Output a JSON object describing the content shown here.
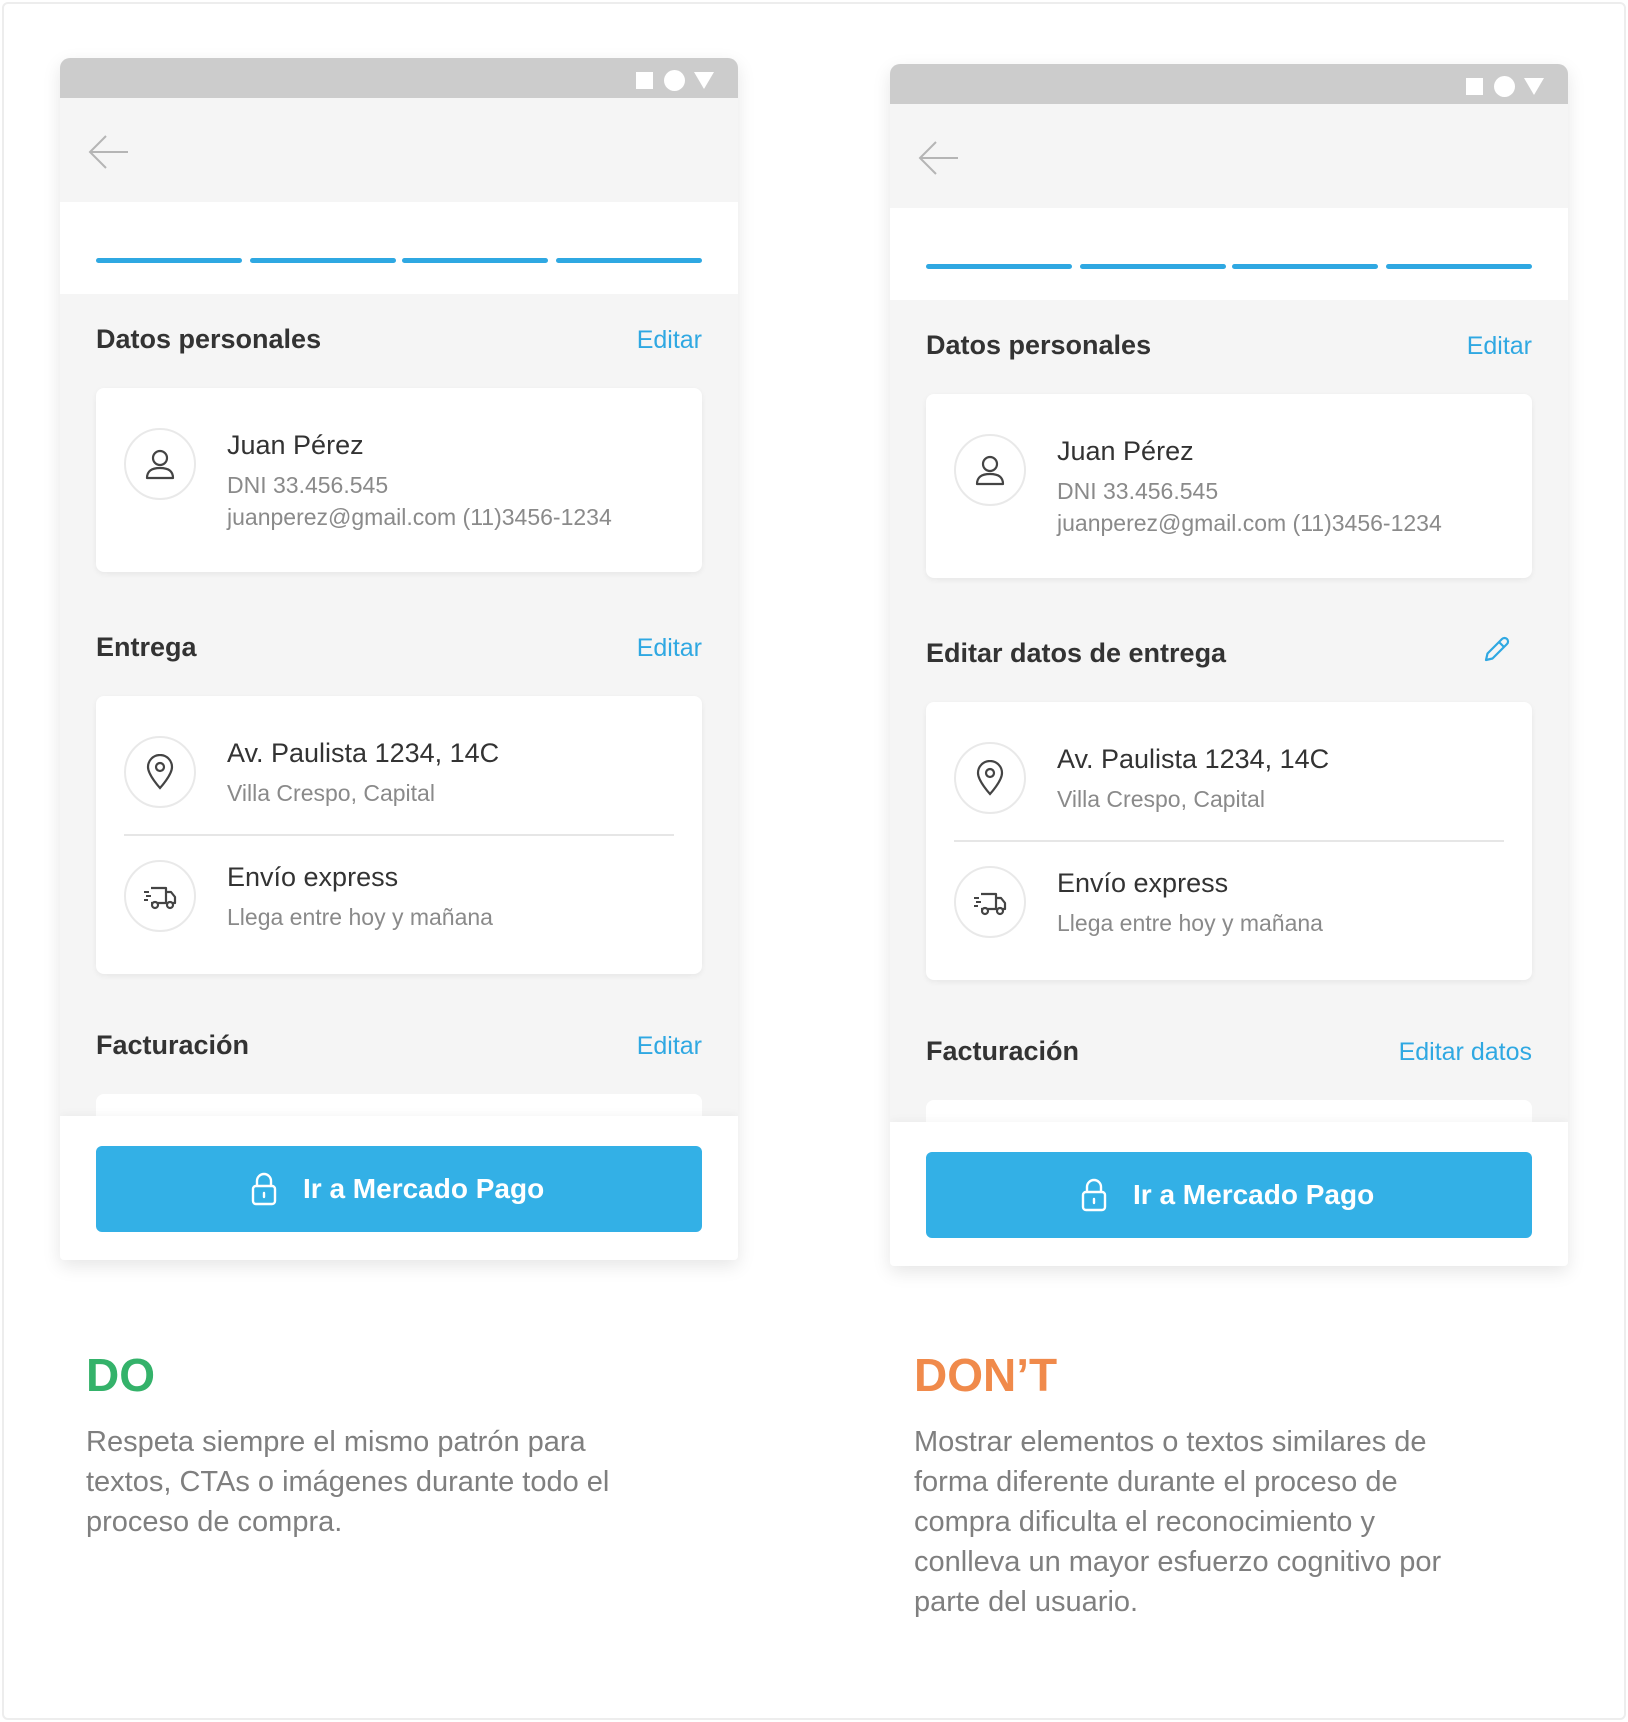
{
  "colors": {
    "accent": "#2fa8e2",
    "cta": "#33b0e6",
    "do": "#34b26a",
    "dont": "#f08a4b"
  },
  "icons": [
    "back-arrow-icon",
    "user-icon",
    "location-pin-icon",
    "truck-icon",
    "lock-icon",
    "pencil-icon",
    "status-square-icon",
    "status-circle-icon",
    "status-triangle-icon"
  ],
  "do_screen": {
    "progress_segments": 4,
    "personal": {
      "title": "Datos personales",
      "edit": "Editar",
      "name": "Juan Pérez",
      "dni": "DNI 33.456.545",
      "contact": "juanperez@gmail.com (11)3456-1234"
    },
    "delivery": {
      "title": "Entrega",
      "edit": "Editar",
      "address": "Av. Paulista 1234, 14C",
      "area": "Villa Crespo, Capital",
      "shipping": "Envío express",
      "eta": "Llega entre hoy y mañana"
    },
    "billing": {
      "title": "Facturación",
      "edit": "Editar"
    },
    "cta": "Ir a Mercado Pago"
  },
  "dont_screen": {
    "progress_segments": 4,
    "personal": {
      "title": "Datos personales",
      "edit": "Editar",
      "name": "Juan Pérez",
      "dni": "DNI 33.456.545",
      "contact": "juanperez@gmail.com (11)3456-1234"
    },
    "delivery": {
      "title": "Editar datos de entrega",
      "address": "Av. Paulista 1234, 14C",
      "area": "Villa Crespo, Capital",
      "shipping": "Envío express",
      "eta": "Llega entre hoy y mañana"
    },
    "billing": {
      "title": "Facturación",
      "edit": "Editar datos"
    },
    "cta": "Ir a Mercado Pago"
  },
  "do": {
    "label": "DO",
    "lines": [
      "Respeta siempre el mismo patrón para",
      "textos, CTAs o imágenes durante todo el",
      "proceso de compra."
    ]
  },
  "dont": {
    "label": "DON’T",
    "lines": [
      "Mostrar elementos o textos similares de",
      "forma diferente durante el proceso de",
      "compra dificulta el reconocimiento y",
      "conlleva un mayor esfuerzo cognitivo por",
      "parte del usuario."
    ]
  }
}
